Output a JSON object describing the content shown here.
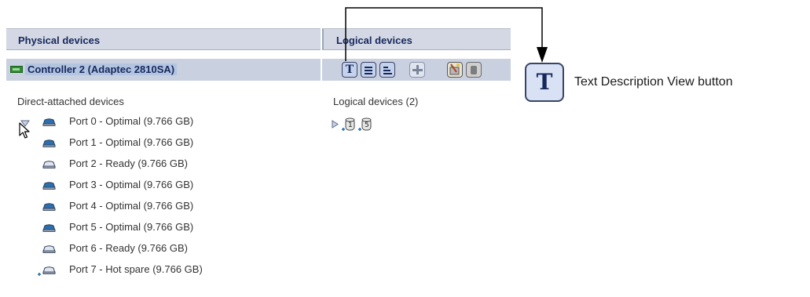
{
  "headers": {
    "physical": "Physical devices",
    "logical": "Logical devices"
  },
  "controller": {
    "label": "Controller 2 (Adaptec 2810SA)",
    "icon": "controller-card-icon"
  },
  "physical": {
    "section_label": "Direct-attached devices",
    "ports": [
      {
        "label": "Port 0 - Optimal (9.766 GB)",
        "status": "optimal"
      },
      {
        "label": "Port 1 - Optimal (9.766 GB)",
        "status": "optimal"
      },
      {
        "label": "Port 2 - Ready (9.766 GB)",
        "status": "ready"
      },
      {
        "label": "Port 3 - Optimal (9.766 GB)",
        "status": "optimal"
      },
      {
        "label": "Port 4 - Optimal (9.766 GB)",
        "status": "optimal"
      },
      {
        "label": "Port 5 - Optimal (9.766 GB)",
        "status": "optimal"
      },
      {
        "label": "Port 6 - Ready (9.766 GB)",
        "status": "ready"
      },
      {
        "label": "Port 7 - Hot spare (9.766 GB)",
        "status": "hotspare"
      }
    ]
  },
  "logical": {
    "section_label": "Logical devices (2)",
    "devices": [
      {
        "raid_level": "1"
      },
      {
        "raid_level": "5"
      }
    ]
  },
  "toolbar": {
    "text_view_glyph": "T",
    "buttons": [
      "text-description-view-icon",
      "list-view-icon",
      "bar-view-icon",
      "add-icon",
      "wizard-icon",
      "delete-icon"
    ]
  },
  "callout": {
    "glyph": "T",
    "label": "Text Description View button"
  },
  "colors": {
    "header_bg": "#d3d8e4",
    "header_text": "#16285c",
    "disk_optimal": "#2a6fb0",
    "disk_ready": "#dfe6f0",
    "selection": "#b2c4e0"
  }
}
